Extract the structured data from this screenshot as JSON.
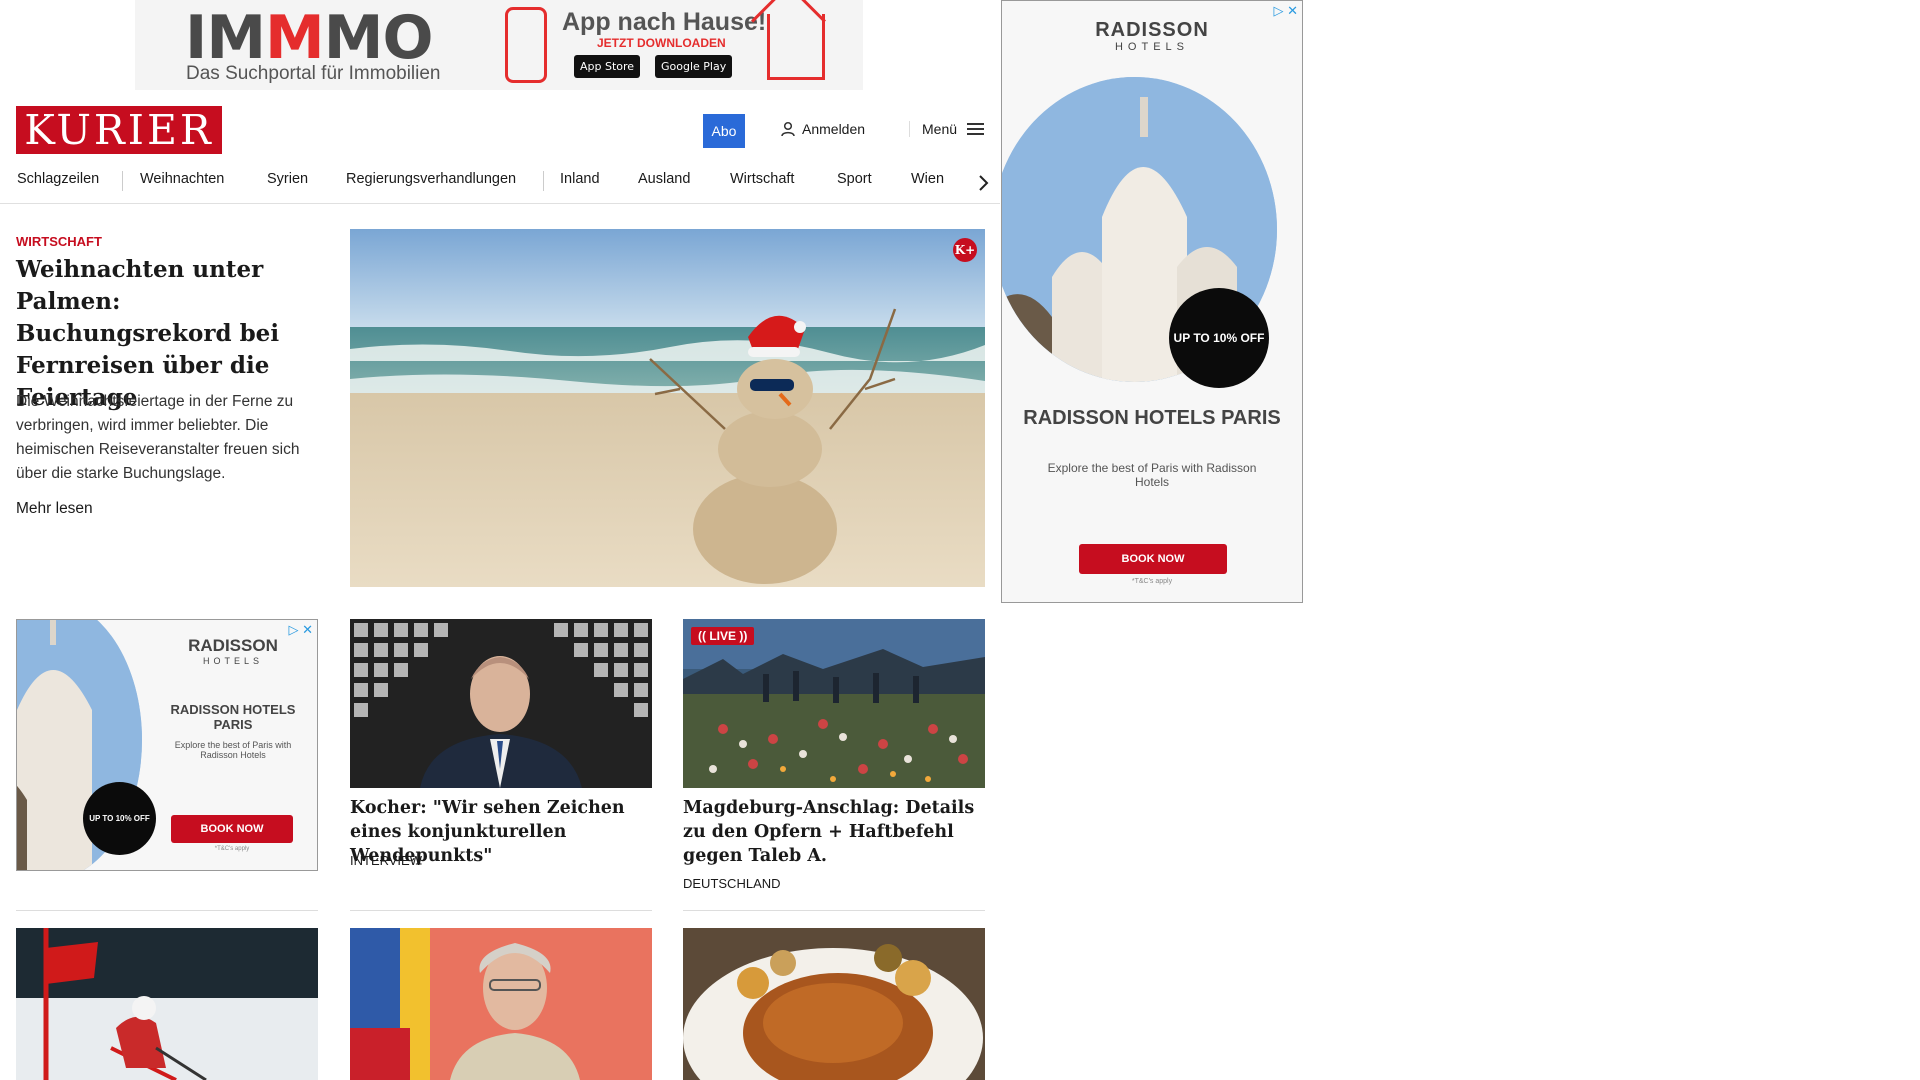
{
  "top_ad": {
    "logo_prefix": "IM",
    "logo_accent": "M",
    "logo_suffix": "MO",
    "tagline": "Das Suchportal für Immobilien",
    "app_title": "App nach Hause!",
    "app_subtitle": "JETZT DOWNLOADEN",
    "app_store": "App Store",
    "google_play": "Google Play"
  },
  "header": {
    "logo": "KURIER",
    "abo": "Abo",
    "login": "Anmelden",
    "menu": "Menü",
    "icons": [
      "user-icon",
      "hamburger-icon",
      "chevron-right-icon"
    ]
  },
  "nav": {
    "items": [
      "Schlagzeilen",
      "Weihnachten",
      "Syrien",
      "Regierungsverhandlungen",
      "Inland",
      "Ausland",
      "Wirtschaft",
      "Sport",
      "Wien"
    ]
  },
  "lead": {
    "category": "WIRTSCHAFT",
    "headline": "Weihnachten unter Pal­men: Buchungsrekord bei Fernreisen über die Feiertage",
    "teaser": "Die Weihnachtsfeiertage in der Ferne zu verbringen, wird immer beliebter. Die heimischen Reiseveranstalter freuen sich über die starke Buchungslage.",
    "more": "Mehr lesen",
    "premium_badge": "K+"
  },
  "side_ad": {
    "brand_top": "RADISSON",
    "brand_sub": "HOTELS",
    "badge": "UP TO 10% OFF",
    "title": "RADISSON HOTELS PARIS",
    "desc": "Explore the best of Paris with Radisson Hotels",
    "cta": "BOOK NOW",
    "terms": "*T&C's apply"
  },
  "inline_ad": {
    "brand_top": "RADISSON",
    "brand_sub": "HOTELS",
    "badge": "UP TO 10% OFF",
    "title": "RADISSON HOTELS PARIS",
    "desc": "Explore the best of Paris with Radisson Hotels",
    "cta": "BOOK NOW",
    "terms": "*T&C's apply"
  },
  "cards": [
    {
      "title": "Kocher: \"Wir sehen Zeichen eines konjunkturellen Wendepunkts\"",
      "tag": "INTERVIEW"
    },
    {
      "title": "Magdeburg-Anschlag: Details zu den Opfern + Haftbefehl gegen Ta­leb A.",
      "tag": "DEUTSCHLAND",
      "live": "(( LIVE ))"
    }
  ]
}
